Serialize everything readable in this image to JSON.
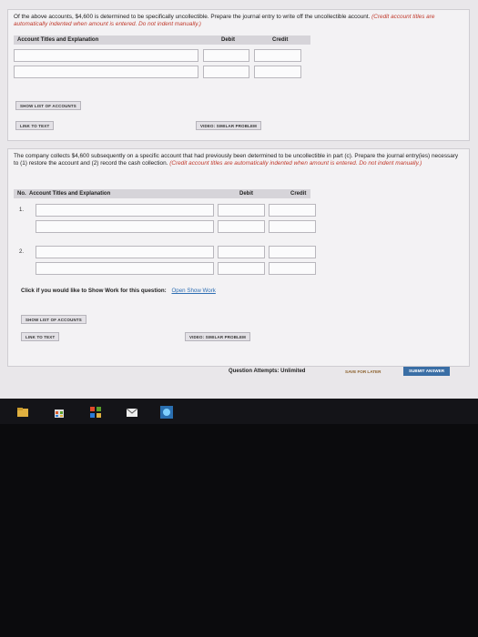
{
  "part1": {
    "prompt": "Of the above accounts, $4,600 is determined to be specifically uncollectible. Prepare the journal entry to write off the uncollectible account.",
    "note": "(Credit account titles are automatically indented when amount is entered. Do not indent manually.)",
    "col_account": "Account Titles and Explanation",
    "col_debit": "Debit",
    "col_credit": "Credit",
    "show_list_button": "SHOW LIST OF ACCOUNTS",
    "link_text_button": "LINK TO TEXT",
    "video_button": "VIDEO: SIMILAR PROBLEM"
  },
  "part2": {
    "prompt": "The company collects $4,600 subsequently on a specific account that had previously been determined to be uncollectible in part (c). Prepare the journal entry(ies) necessary to (1) restore the account and (2) record the cash collection.",
    "note": "(Credit account titles are automatically indented when amount is entered. Do not indent manually.)",
    "col_no": "No.",
    "col_account": "Account Titles and Explanation",
    "col_debit": "Debit",
    "col_credit": "Credit",
    "row1": "1.",
    "row2": "2.",
    "show_work_prompt": "Click if you would like to Show Work for this question:",
    "show_work_link": "Open Show Work",
    "show_list_button": "SHOW LIST OF ACCOUNTS",
    "link_text_button": "LINK TO TEXT",
    "video_button": "VIDEO: SIMILAR PROBLEM"
  },
  "footer": {
    "attempts": "Question Attempts: Unlimited",
    "save_later": "SAVE FOR LATER",
    "submit": "SUBMIT ANSWER"
  },
  "taskbar": {
    "icons": [
      "file-manager-icon",
      "store-icon",
      "office-icon",
      "mail-icon",
      "browser-icon"
    ]
  }
}
